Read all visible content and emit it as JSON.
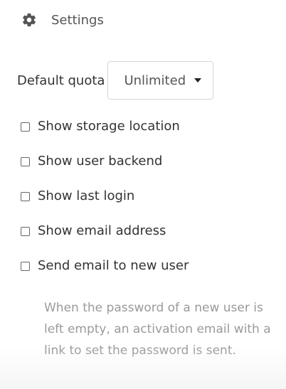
{
  "header": {
    "icon": "gear-icon",
    "title": "Settings"
  },
  "quota": {
    "label": "Default quota",
    "selected": "Unlimited"
  },
  "options": [
    {
      "label": "Show storage location",
      "checked": false
    },
    {
      "label": "Show user backend",
      "checked": false
    },
    {
      "label": "Show last login",
      "checked": false
    },
    {
      "label": "Show email address",
      "checked": false
    },
    {
      "label": "Send email to new user",
      "checked": false
    }
  ],
  "hint": "When the password of a new user is left empty, an activation email with a link to set the password is sent.",
  "colors": {
    "text": "#333333",
    "muted": "#9a9a9a",
    "border": "#d6d6d6"
  }
}
